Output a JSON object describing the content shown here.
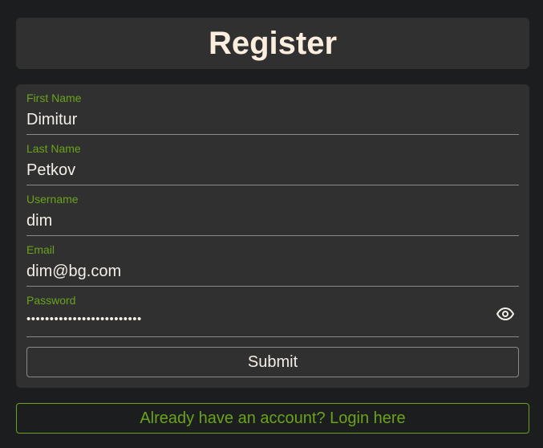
{
  "header": {
    "title": "Register"
  },
  "form": {
    "fields": [
      {
        "label": "First Name",
        "value": "Dimitur"
      },
      {
        "label": "Last Name",
        "value": "Petkov"
      },
      {
        "label": "Username",
        "value": "dim"
      },
      {
        "label": "Email",
        "value": "dim@bg.com"
      },
      {
        "label": "Password",
        "value": "•••••••••••••••••••••••••",
        "toggle_icon": "eye-icon"
      }
    ],
    "submit_label": "Submit"
  },
  "footer": {
    "login_link_label": "Already have an account? Login here"
  },
  "colors": {
    "background": "#1c1d1f",
    "card": "#303030",
    "accent": "#6aa31b",
    "text": "#f3eee6",
    "title": "#fbeede"
  }
}
